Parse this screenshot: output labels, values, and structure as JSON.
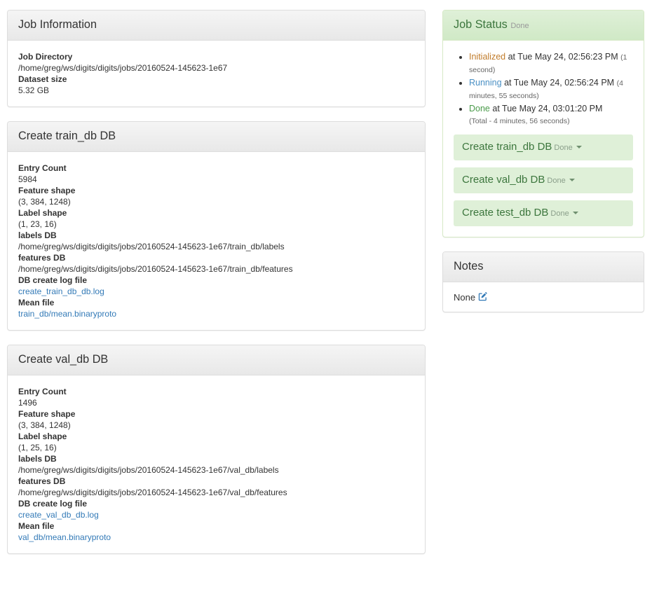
{
  "left_column": {
    "job_information": {
      "title": "Job Information",
      "fields": [
        {
          "label": "Job Directory",
          "value": "/home/greg/ws/digits/digits/jobs/20160524-145623-1e67",
          "type": "text"
        },
        {
          "label": "Dataset size",
          "value": "5.32 GB",
          "type": "text"
        }
      ]
    },
    "create_train_db": {
      "title": "Create train_db DB",
      "fields": [
        {
          "label": "Entry Count",
          "value": "5984",
          "type": "text"
        },
        {
          "label": "Feature shape",
          "value": "(3, 384, 1248)",
          "type": "text"
        },
        {
          "label": "Label shape",
          "value": "(1, 23, 16)",
          "type": "text"
        },
        {
          "label": "labels DB",
          "value": "/home/greg/ws/digits/digits/jobs/20160524-145623-1e67/train_db/labels",
          "type": "text"
        },
        {
          "label": "features DB",
          "value": "/home/greg/ws/digits/digits/jobs/20160524-145623-1e67/train_db/features",
          "type": "text"
        },
        {
          "label": "DB create log file",
          "value": "create_train_db_db.log",
          "type": "link"
        },
        {
          "label": "Mean file",
          "value": "train_db/mean.binaryproto",
          "type": "link"
        }
      ]
    },
    "create_val_db": {
      "title": "Create val_db DB",
      "fields": [
        {
          "label": "Entry Count",
          "value": "1496",
          "type": "text"
        },
        {
          "label": "Feature shape",
          "value": "(3, 384, 1248)",
          "type": "text"
        },
        {
          "label": "Label shape",
          "value": "(1, 25, 16)",
          "type": "text"
        },
        {
          "label": "labels DB",
          "value": "/home/greg/ws/digits/digits/jobs/20160524-145623-1e67/val_db/labels",
          "type": "text"
        },
        {
          "label": "features DB",
          "value": "/home/greg/ws/digits/digits/jobs/20160524-145623-1e67/val_db/features",
          "type": "text"
        },
        {
          "label": "DB create log file",
          "value": "create_val_db_db.log",
          "type": "link"
        },
        {
          "label": "Mean file",
          "value": "val_db/mean.binaryproto",
          "type": "link"
        }
      ]
    }
  },
  "right_column": {
    "job_status": {
      "title": "Job Status",
      "state": "Done",
      "events": [
        {
          "status": "Initialized",
          "status_color": "#c17c2b",
          "at": "at Tue May 24, 02:56:23 PM",
          "duration": "(1 second)"
        },
        {
          "status": "Running",
          "status_color": "#4a90c4",
          "at": "at Tue May 24, 02:56:24 PM",
          "duration": "(4 minutes, 55 seconds)"
        },
        {
          "status": "Done",
          "status_color": "#4b9b4b",
          "at": "at Tue May 24, 03:01:20 PM",
          "duration": "(Total - 4 minutes, 56 seconds)"
        }
      ],
      "tasks": [
        {
          "label": "Create train_db DB",
          "state": "Done",
          "icon": "caret-down-icon"
        },
        {
          "label": "Create val_db DB",
          "state": "Done",
          "icon": "caret-down-icon"
        },
        {
          "label": "Create test_db DB",
          "state": "Done",
          "icon": "caret-down-icon"
        }
      ]
    },
    "notes": {
      "title": "Notes",
      "value": "None",
      "edit_icon": "pencil-square-icon"
    }
  },
  "colors": {
    "link": "#337ab7",
    "success_bg": "#dff0d8",
    "success_text": "#3c763d",
    "success_border": "#d6e9c6",
    "panel_border": "#dddddd",
    "heading_gradient_top": "#f5f5f5",
    "heading_gradient_bottom": "#e8e8e8",
    "text": "#333333",
    "muted": "#999999"
  }
}
